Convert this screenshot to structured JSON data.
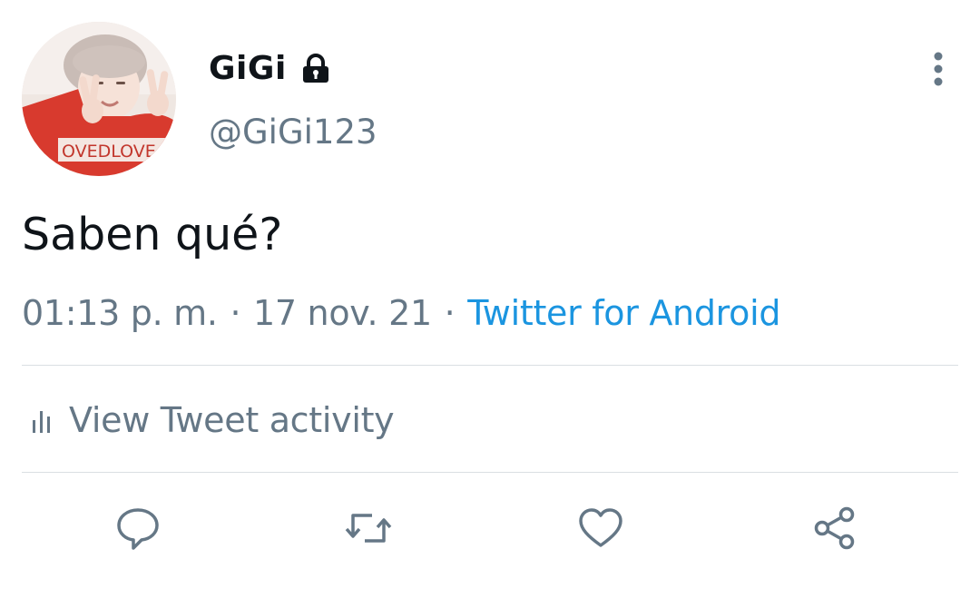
{
  "tweet": {
    "display_name": "GiGi",
    "username": "@GiGi123",
    "text": "Saben qué?",
    "time": "01:13 p. m.",
    "separator": "·",
    "date": "17 nov. 21",
    "source": "Twitter for Android",
    "protected_icon": "lock-icon"
  },
  "avatar": {
    "shirt_text": "OVEDLOVE"
  },
  "activity": {
    "label": "View Tweet activity",
    "icon": "bar-chart-icon"
  },
  "actions": [
    {
      "icon": "reply-icon"
    },
    {
      "icon": "retweet-icon"
    },
    {
      "icon": "like-icon"
    },
    {
      "icon": "share-icon"
    }
  ],
  "more_icon": "more-vertical-icon",
  "colors": {
    "text": "#0f1419",
    "secondary": "#657786",
    "link": "#1b95e0",
    "divider": "#dadfe3"
  }
}
